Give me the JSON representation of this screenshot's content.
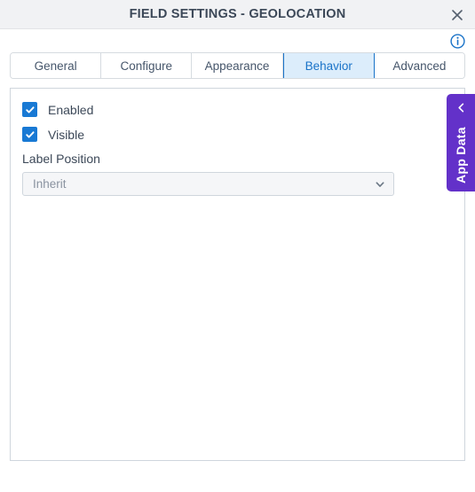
{
  "dialog": {
    "title": "FIELD SETTINGS - GEOLOCATION",
    "close_icon": "close-icon",
    "info_icon": "info-icon"
  },
  "tabs": [
    {
      "label": "General",
      "active": false
    },
    {
      "label": "Configure",
      "active": false
    },
    {
      "label": "Appearance",
      "active": false
    },
    {
      "label": "Behavior",
      "active": true
    },
    {
      "label": "Advanced",
      "active": false
    }
  ],
  "form": {
    "enabled": {
      "label": "Enabled",
      "checked": true
    },
    "visible": {
      "label": "Visible",
      "checked": true
    },
    "label_position": {
      "label": "Label Position",
      "value": "Inherit",
      "placeholder": "Inherit",
      "chevron_icon": "chevron-down-icon"
    }
  },
  "app_data_tab": {
    "label": "App Data",
    "chevron_icon": "chevron-left-icon"
  },
  "colors": {
    "titlebar_bg": "#f1f2f4",
    "title_text": "#3c4858",
    "accent_blue": "#1a73c8",
    "checkbox_blue": "#1879d4",
    "active_tab_bg": "#dcedfb",
    "app_data_purple": "#6331c9",
    "panel_border": "#cfd6dd",
    "placeholder_text": "#8a93a0"
  }
}
